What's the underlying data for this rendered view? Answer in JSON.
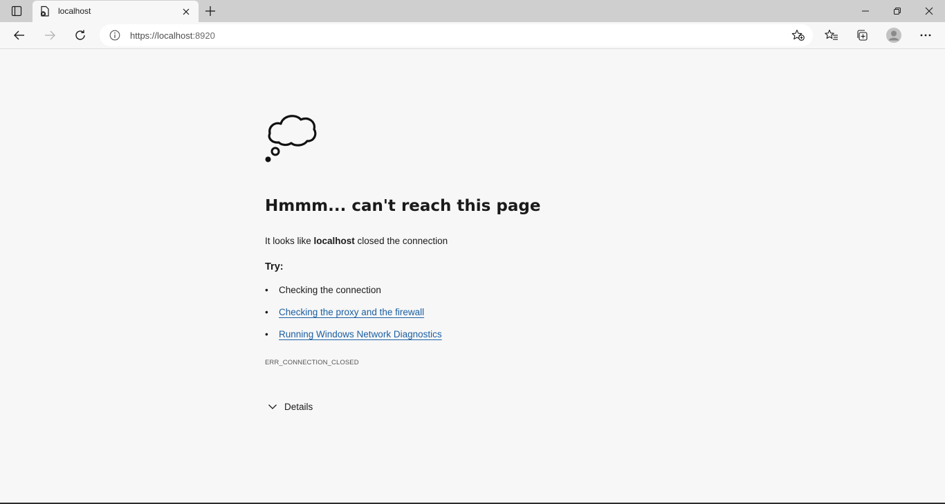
{
  "browser": {
    "tab": {
      "title": "localhost"
    },
    "address": {
      "scheme_host": "https://localhost",
      "port": ":8920"
    },
    "icons": {
      "tab_actions": "tab-actions-icon",
      "favicon": "page-error-icon",
      "close": "close-icon",
      "new_tab": "plus-icon",
      "back": "back-arrow-icon",
      "forward": "forward-arrow-icon",
      "refresh": "refresh-icon",
      "info": "info-icon",
      "add_favorite": "star-add-icon",
      "favorites": "favorites-icon",
      "collections": "collections-icon",
      "profile": "profile-avatar",
      "more": "more-icon",
      "minimize": "minimize-icon",
      "restore": "restore-icon",
      "window_close": "window-close-icon"
    }
  },
  "error_page": {
    "heading": "Hmmm... can't reach this page",
    "lead_prefix": "It looks like ",
    "lead_host": "localhost",
    "lead_suffix": " closed the connection",
    "try_label": "Try:",
    "suggestions": [
      {
        "text": "Checking the connection",
        "is_link": false
      },
      {
        "text": "Checking the proxy and the firewall",
        "is_link": true
      },
      {
        "text": "Running Windows Network Diagnostics",
        "is_link": true
      }
    ],
    "bullet": "•",
    "error_code": "ERR_CONNECTION_CLOSED",
    "details_label": "Details"
  },
  "colors": {
    "tabstrip": "#cfcfcf",
    "page_background": "#f7f7f7",
    "link": "#1a5fa3"
  }
}
